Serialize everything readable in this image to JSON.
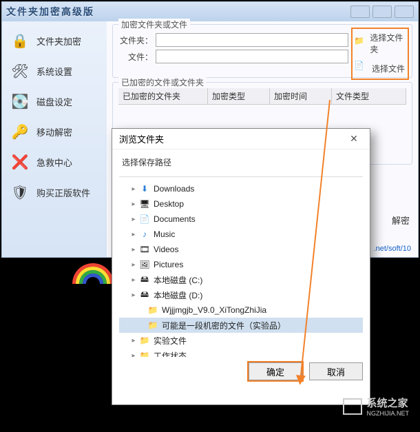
{
  "window": {
    "title": "文件夹加密高级版"
  },
  "sidebar": {
    "items": [
      {
        "label": "文件夹加密"
      },
      {
        "label": "系统设置"
      },
      {
        "label": "磁盘设定"
      },
      {
        "label": "移动解密"
      },
      {
        "label": "急救中心"
      },
      {
        "label": "购买正版软件"
      }
    ]
  },
  "encrypt_group": {
    "legend": "加密文件夹或文件",
    "row_folder": "文件夹：",
    "row_file": "文件：",
    "btn_folder": "选择文件夹",
    "btn_file": "选择文件"
  },
  "table": {
    "legend": "已加密的文件或文件夹",
    "cols": [
      "已加密的文件夹",
      "加密类型",
      "加密时间",
      "文件类型"
    ]
  },
  "decrypt": "解密",
  "link_tail": ".net/soft/10",
  "dialog": {
    "title": "浏览文件夹",
    "subtitle": "选择保存路径",
    "ok": "确定",
    "cancel": "取消",
    "tree": [
      {
        "label": "Downloads",
        "icon": "i-dl",
        "exp": "▸"
      },
      {
        "label": "Desktop",
        "icon": "i-desktop",
        "exp": "▸"
      },
      {
        "label": "Documents",
        "icon": "i-doc",
        "exp": "▸"
      },
      {
        "label": "Music",
        "icon": "i-music",
        "exp": "▸"
      },
      {
        "label": "Videos",
        "icon": "i-video",
        "exp": "▸"
      },
      {
        "label": "Pictures",
        "icon": "i-pic",
        "exp": "▸"
      },
      {
        "label": "本地磁盘 (C:)",
        "icon": "i-drive",
        "exp": "▸"
      },
      {
        "label": "本地磁盘 (D:)",
        "icon": "i-drive",
        "exp": "▸"
      },
      {
        "label": "Wjjjmgjb_V9.0_XiTongZhiJia",
        "icon": "i-folder",
        "exp": ""
      },
      {
        "label": "可能是一段机密的文件（实验品）",
        "icon": "i-folder",
        "exp": "",
        "selected": true
      },
      {
        "label": "实验文件",
        "icon": "i-folder",
        "exp": "▸"
      },
      {
        "label": "工作状态",
        "icon": "i-folder",
        "exp": "▸"
      }
    ]
  },
  "watermark": {
    "brand": "系统之家",
    "domain": "NGZHIJIA.NET"
  }
}
